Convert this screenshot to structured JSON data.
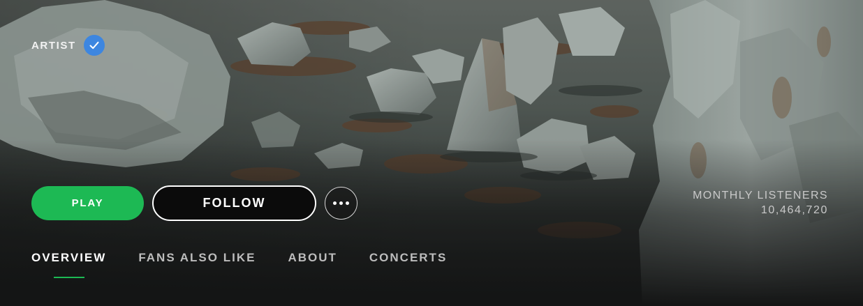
{
  "header": {
    "type_label": "ARTIST",
    "verified": true,
    "accent_color": "#1db954",
    "verified_color": "#3d86e0"
  },
  "actions": {
    "play_label": "PLAY",
    "follow_label": "FOLLOW",
    "more_icon": "more-horizontal-icon"
  },
  "stats": {
    "monthly_listeners_label": "MONTHLY LISTENERS",
    "monthly_listeners_value": "10,464,720"
  },
  "tabs": [
    {
      "label": "OVERVIEW",
      "active": true
    },
    {
      "label": "FANS ALSO LIKE",
      "active": false
    },
    {
      "label": "ABOUT",
      "active": false
    },
    {
      "label": "CONCERTS",
      "active": false
    }
  ]
}
